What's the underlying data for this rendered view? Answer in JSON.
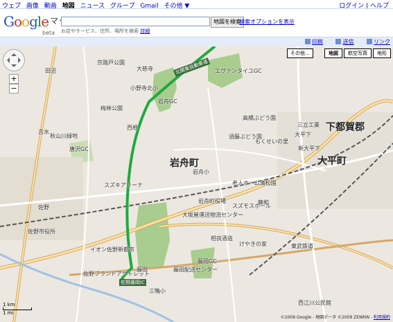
{
  "nav": {
    "items": [
      "ウェブ",
      "画像",
      "動画",
      "地図",
      "ニュース",
      "グループ",
      "Gmail",
      "その他 ▼"
    ],
    "selected_index": 3,
    "login": "ログイン",
    "help": "ヘルプ"
  },
  "header": {
    "logo": "Google",
    "logo_sub": "マップ",
    "beta": "beta",
    "search_value": "",
    "search_button": "地図を検索",
    "options_link": "検索オプションを表示",
    "hint": "お店やサービス、住所、場所を検索",
    "hint_link": "詳細"
  },
  "toolbar": {
    "print": "印刷",
    "send": "送信",
    "link": "リンク"
  },
  "map": {
    "maptypes": [
      "地図",
      "航空写真",
      "地形"
    ],
    "active_maptype": "地図",
    "other": "その他...",
    "scale_top": "1 km",
    "scale_bottom": "1 mi",
    "copyright": "©2009 Google - 地図データ ©2009 ZENRIN -",
    "terms": "利用規約",
    "big_labels": [
      "岩舟町",
      "大平町",
      "下都賀郡"
    ],
    "labels": [
      "京路戸公園",
      "大慈寺",
      "エヴァンタイユGC",
      "小野寺北小",
      "岩舟GC",
      "梅林公園",
      "西根",
      "高橋ぶどう園",
      "須藤ぶどう園",
      "もくせいの里",
      "唐沢GC",
      "秋山川緑地",
      "スズキアリーナ",
      "大平下",
      "新大平下",
      "三立工業",
      "佐野市役所",
      "佐野",
      "佐野ブランドアウトレット",
      "イオン佐野新都市",
      "岩舟町役場",
      "老人ホーム清松園",
      "藤田配送センター",
      "東武鉄道",
      "相良酒造",
      "けやきの家",
      "岩舟小",
      "田沼",
      "吉水",
      "佐野藤岡IC",
      "北関東自動車道",
      "スズモスホール",
      "藤岡GC",
      "大坂屋運送物流センター",
      "静和",
      "藤田",
      "三鴨小",
      "西江川公民館",
      "藤岡GC"
    ]
  },
  "colors": {
    "highway": "#1faa3e",
    "park": "#a9cc8f",
    "base": "#ece8e1",
    "road_major": "#ffffff",
    "road_outline": "#d5a867"
  }
}
